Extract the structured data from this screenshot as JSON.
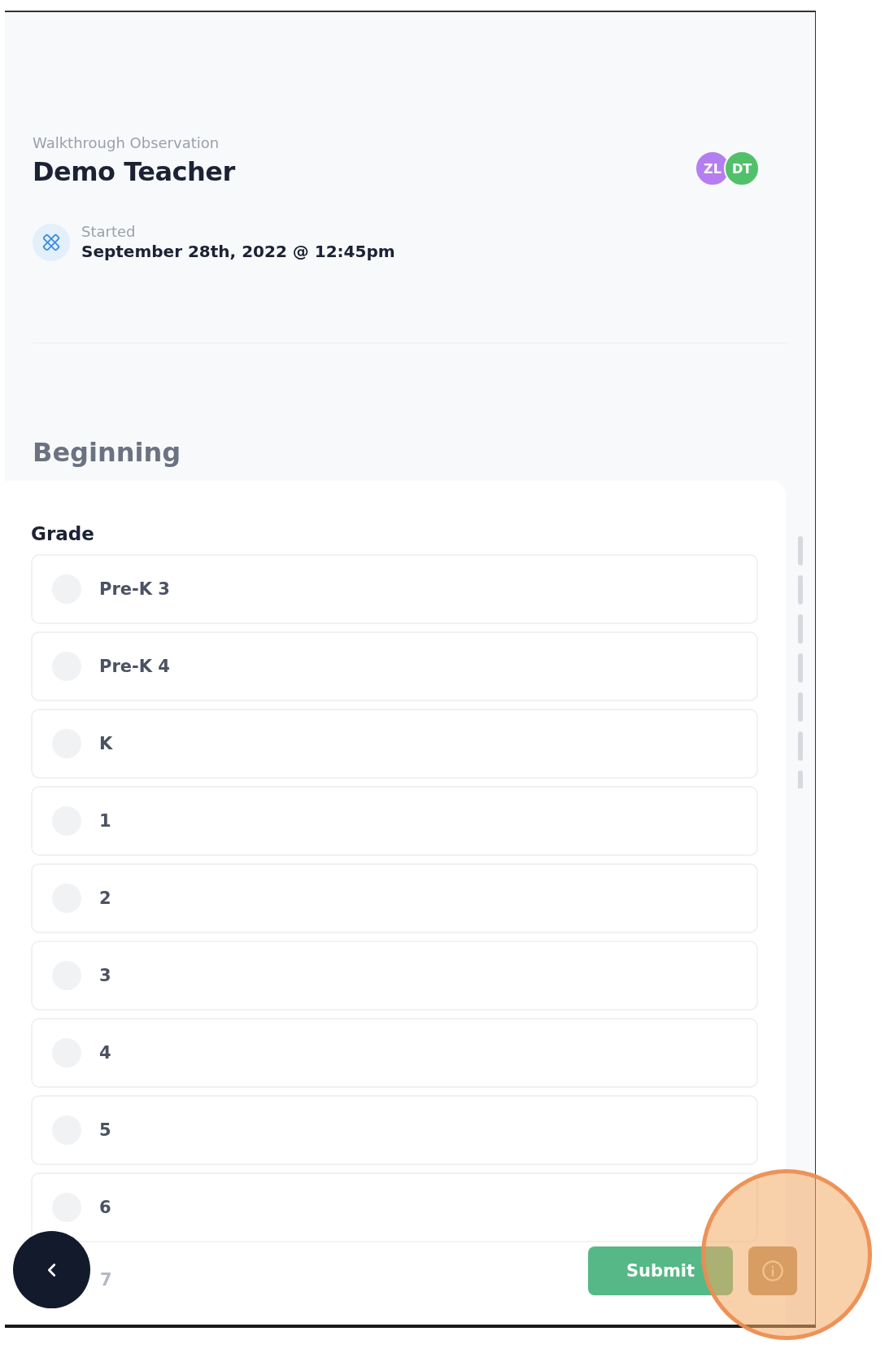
{
  "header": {
    "subtitle": "Walkthrough Observation",
    "title": "Demo Teacher",
    "avatars": [
      {
        "initials": "ZL",
        "color": "#b57ef0"
      },
      {
        "initials": "DT",
        "color": "#52c06a"
      }
    ],
    "started": {
      "label": "Started",
      "value": "September 28th, 2022 @ 12:45pm"
    }
  },
  "section": {
    "title": "Beginning",
    "question": "Grade",
    "options": [
      {
        "kind": "row",
        "label": "Pre-K 3",
        "selected": false
      },
      {
        "kind": "row",
        "label": "Pre-K 4",
        "selected": false
      },
      {
        "kind": "row",
        "label": "K",
        "selected": false
      },
      {
        "kind": "row",
        "label": "1",
        "selected": false
      },
      {
        "kind": "row",
        "label": "2",
        "selected": false
      },
      {
        "kind": "row",
        "label": "3",
        "selected": false
      },
      {
        "kind": "row",
        "label": "4",
        "selected": false
      },
      {
        "kind": "row",
        "label": "5",
        "selected": false
      },
      {
        "kind": "row",
        "label": "6",
        "selected": false
      },
      {
        "kind": "faded",
        "label": "7"
      }
    ]
  },
  "actions": {
    "submit": "Submit"
  }
}
